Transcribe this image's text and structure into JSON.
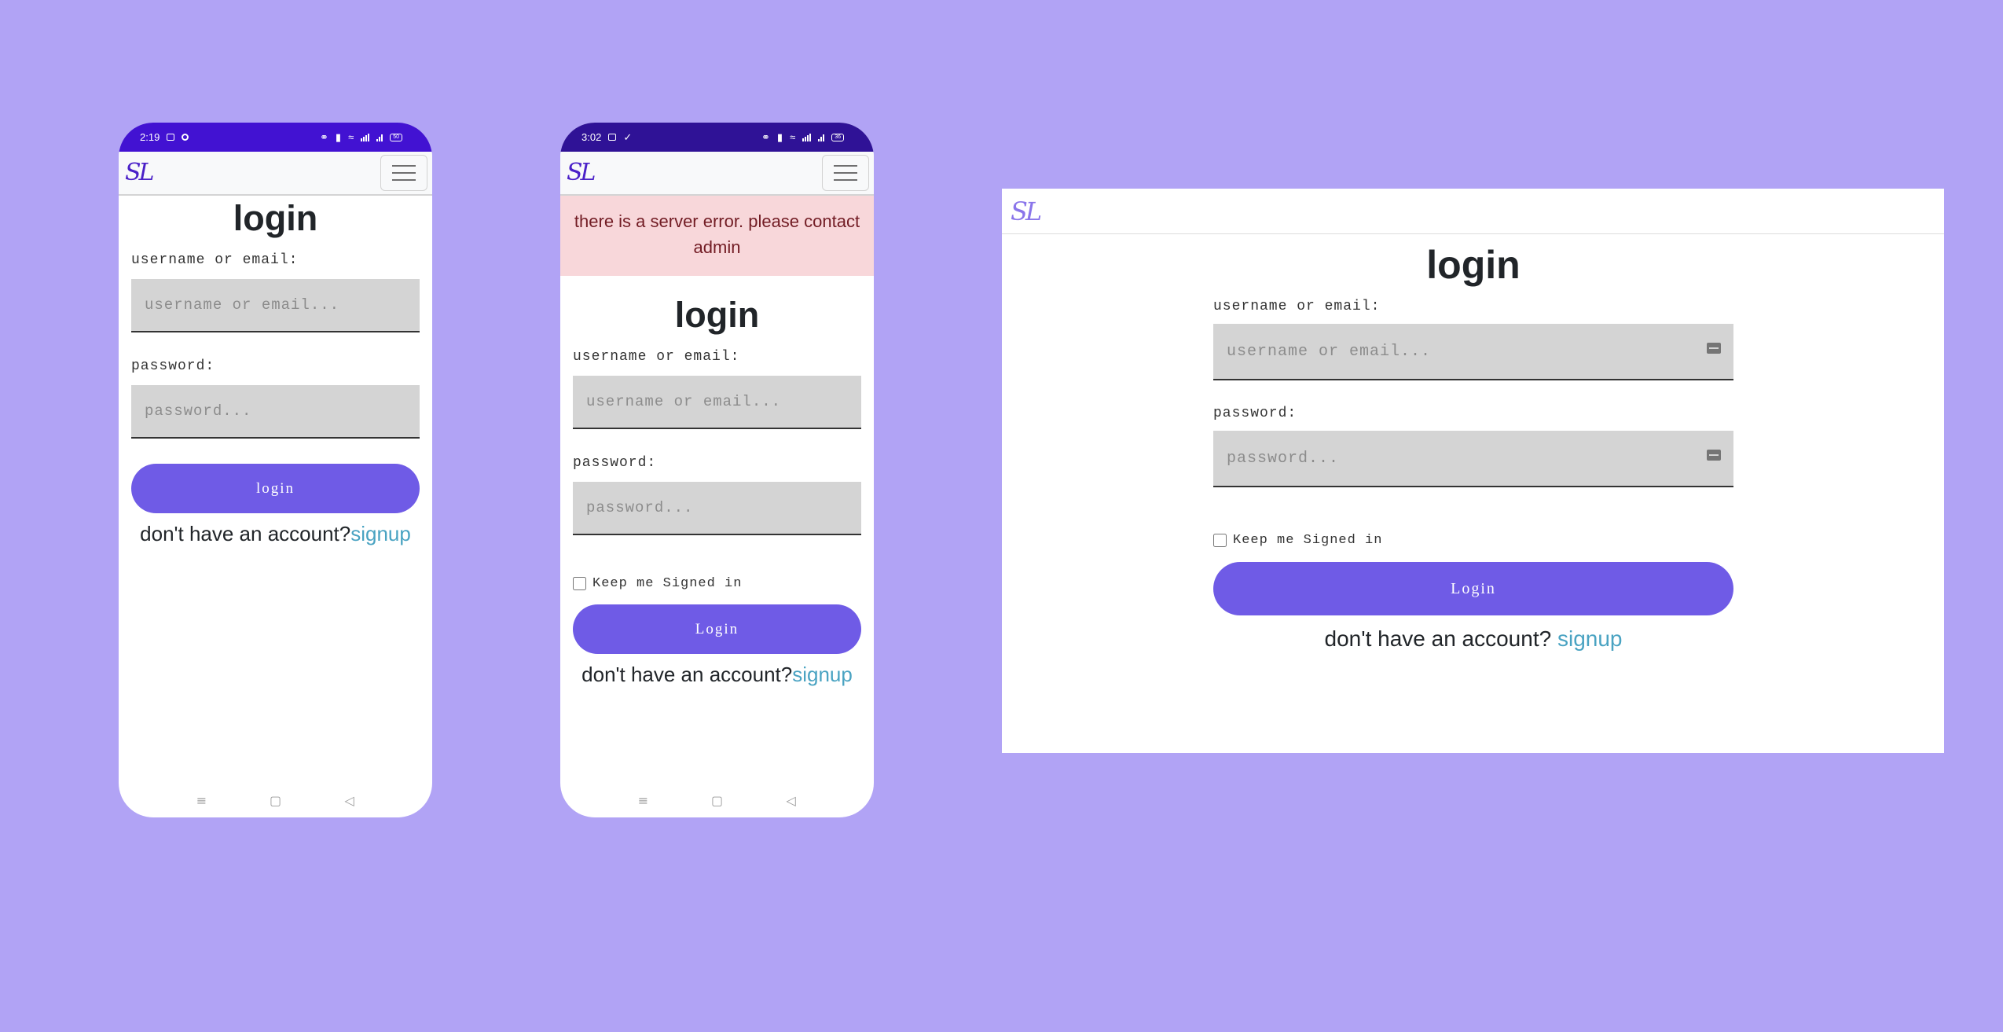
{
  "phone1": {
    "status": {
      "time": "2:19",
      "battery": "50"
    },
    "navbar": {
      "logo": "SL"
    },
    "form": {
      "title": "login",
      "username_label": "username or email:",
      "username_placeholder": "username or email...",
      "password_label": "password:",
      "password_placeholder": "password...",
      "submit_label": "login",
      "signup_prompt": "don't have an account?",
      "signup_link": "signup"
    }
  },
  "phone2": {
    "status": {
      "time": "3:02",
      "battery": "36"
    },
    "navbar": {
      "logo": "SL"
    },
    "alert": {
      "message": "there is a server error. please contact admin"
    },
    "form": {
      "title": "login",
      "username_label": "username or email:",
      "username_placeholder": "username or email...",
      "password_label": "password:",
      "password_placeholder": "password...",
      "remember_label": "Keep me Signed in",
      "remember_checked": false,
      "submit_label": "Login",
      "signup_prompt": "don't have an account?",
      "signup_link": "signup"
    }
  },
  "desktop": {
    "navbar": {
      "logo": "SL"
    },
    "form": {
      "title": "login",
      "username_label": "username or email:",
      "username_placeholder": "username or email...",
      "password_label": "password:",
      "password_placeholder": "password...",
      "remember_label": "Keep me Signed in",
      "remember_checked": false,
      "submit_label": "Login",
      "signup_prompt": "don't have an account? ",
      "signup_link": "signup"
    }
  },
  "icons": {
    "system_nav": [
      "menu-icon",
      "home-icon",
      "back-icon"
    ],
    "password_manager": "key-icon",
    "navbar_toggle": "hamburger-icon"
  },
  "colors": {
    "background": "#b1a3f5",
    "primary_button": "#6f5be6",
    "link": "#4aa3c2",
    "alert_bg": "#f8d7da",
    "alert_text": "#721c24",
    "input_bg": "#d4d4d4"
  }
}
